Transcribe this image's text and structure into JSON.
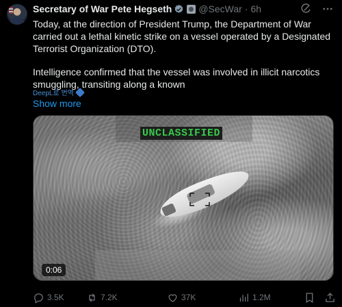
{
  "post": {
    "author_name": "Secretary of War Pete Hegseth",
    "handle": "@SecWar",
    "separator": "·",
    "time": "6h",
    "text_p1": "Today, at the direction of President Trump, the Department of War carried out a lethal kinetic strike on a vessel operated by a Designated Terrorist Organization (DTO).",
    "text_p2": "Intelligence confirmed that the vessel was involved in illicit narcotics smuggling, transiting along a known",
    "translate_label": "DeepL로 번역",
    "show_more": "Show more"
  },
  "video": {
    "overlay_label": "UNCLASSIFIED",
    "timestamp": "0:06"
  },
  "actions": {
    "replies": "3.5K",
    "reposts": "7.2K",
    "likes": "37K",
    "views": "1.2M"
  },
  "icons": {
    "verified": "verified-badge-icon",
    "affiliation": "affiliation-badge-icon",
    "grok": "grok-icon",
    "more": "more-icon",
    "reply": "reply-icon",
    "repost": "repost-icon",
    "like": "like-icon",
    "views": "views-icon",
    "bookmark": "bookmark-icon",
    "share": "share-icon"
  },
  "colors": {
    "background": "#000000",
    "text": "#e7e9ea",
    "muted": "#71767b",
    "link": "#1d9bf0",
    "verified": "#829aab",
    "overlay_text": "#38c94a"
  }
}
